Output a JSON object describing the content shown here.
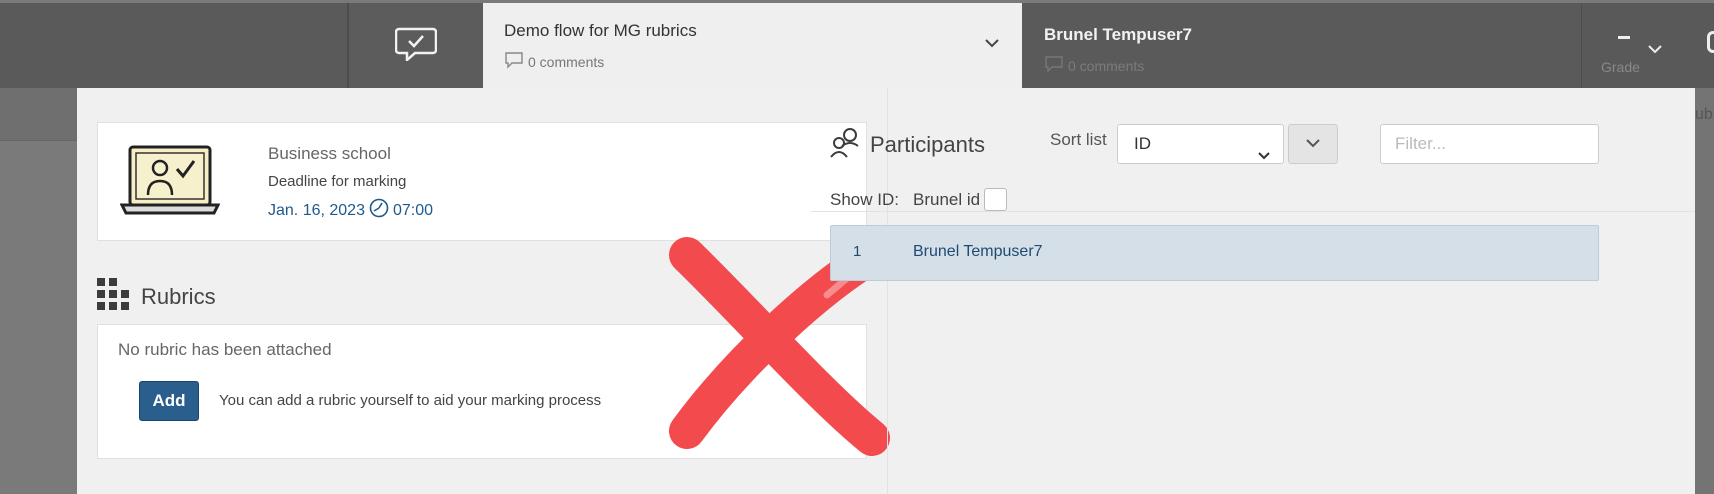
{
  "header": {
    "flow_title": "Demo flow for MG rubrics",
    "flow_comments": "0 comments",
    "user_name": "Brunel Tempuser7",
    "user_comments": "0 comments",
    "grade_label": "Grade"
  },
  "right_edge_text": "ubr",
  "info": {
    "school": "Business school",
    "deadline_label": "Deadline for marking",
    "deadline_date": "Jan. 16, 2023",
    "deadline_time": "07:00"
  },
  "rubrics": {
    "heading": "Rubrics",
    "empty_text": "No rubric has been attached",
    "add_label": "Add",
    "hint": "You can add a rubric yourself to aid your marking process"
  },
  "participants": {
    "heading": "Participants",
    "sort_label": "Sort list",
    "sort_value": "ID",
    "filter_placeholder": "Filter...",
    "show_id_label": "Show ID:",
    "show_id_option": "Brunel id",
    "rows": [
      {
        "num": "1",
        "name": "Brunel Tempuser7"
      }
    ]
  },
  "colors": {
    "accent": "#2a5e8c",
    "link": "#1f5a8c",
    "x_mark": "#f24a4d"
  },
  "icons": [
    "chat-check-icon",
    "comment-icon",
    "chevron-down-icon",
    "laptop-user-icon",
    "clock-icon",
    "grid-icon",
    "participants-icon"
  ]
}
